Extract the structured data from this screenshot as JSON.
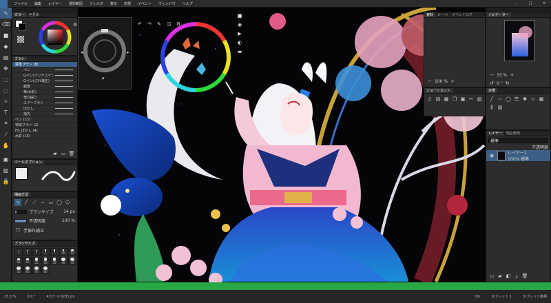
{
  "menu": [
    "ファイル",
    "編集",
    "レイヤー",
    "選択範囲",
    "フィルタ",
    "表示",
    "定規",
    "イベント",
    "ウィンドウ",
    "ヘルプ"
  ],
  "color_panel": {
    "tabs": [
      "カラー",
      "色見本"
    ]
  },
  "brush_panel": {
    "title": "ブラシ",
    "group": "標準ブラシ (8)",
    "items": [
      "ペン",
      "Gペン(アンチエイリアス)",
      "Gペン(ぶれ補正)",
      "鉛筆",
      "筆(水彩)",
      "筆(油彩)",
      "エアーブラシ",
      "ぼかし",
      "指先"
    ],
    "folders": [
      "ペン (13)",
      "特殊ブラシ (2)",
      "Hs_ぼかし (4)",
      "水彩 (15)"
    ]
  },
  "tool_option": {
    "title": "ツールオプション"
  },
  "drawing": {
    "title": "描画方法",
    "brush_size_label": "ブラシサイズ",
    "brush_size_value": "14 px",
    "opacity_label": "不透明度",
    "opacity_value": "100 %",
    "opacity_fraction": 1.0,
    "brush_size_fraction": 0.14,
    "stabilizer_label": "手振れ補正"
  },
  "brush_sizes": {
    "title": "ブラシサイズ",
    "values": [
      "1",
      "2",
      "3",
      "5",
      "7",
      "10",
      "12",
      "16",
      "20",
      "25",
      "30",
      "35",
      "40",
      "45",
      "50",
      "60",
      "70",
      "80"
    ]
  },
  "layer_info_panel": {
    "tabs": [
      "資料",
      "ルーペ",
      "イベントログ"
    ],
    "zoom": "100 %"
  },
  "shortcut_panel": {
    "title": "ショートカット"
  },
  "navigator": {
    "title": "ナビゲーター",
    "zoom": "33 %",
    "angle": "0 °"
  },
  "layers": {
    "tabs": [
      "レイヤー",
      "現在使用"
    ],
    "blend_mode": "標準",
    "opacity": "不透明度",
    "layer_name": "レイヤー1",
    "layer_detail": "100% 標準"
  },
  "status": {
    "zoom": "33.3 %",
    "angle": "0.0 °",
    "size": "4727 × 6265 px",
    "on": "On",
    "tablet": "タブレット 1",
    "tablet_mode": "タブレット座標"
  },
  "colors": {
    "accent": "#3b5f86",
    "bar_green": "#28a745",
    "canvas_pink": "#e05a8a",
    "canvas_red": "#b3263b"
  }
}
